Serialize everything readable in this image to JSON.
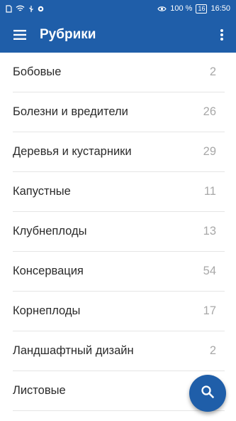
{
  "statusbar": {
    "battery_percent": "100 %",
    "time": "16:50",
    "battery_level": "16"
  },
  "appbar": {
    "title": "Рубрики"
  },
  "categories": [
    {
      "label": "Бобовые",
      "count": "2"
    },
    {
      "label": "Болезни и вредители",
      "count": "26"
    },
    {
      "label": "Деревья и кустарники",
      "count": "29"
    },
    {
      "label": "Капустные",
      "count": "11"
    },
    {
      "label": "Клубнеплоды",
      "count": "13"
    },
    {
      "label": "Консервация",
      "count": "54"
    },
    {
      "label": "Корнеплоды",
      "count": "17"
    },
    {
      "label": "Ландшафтный дизайн",
      "count": "2"
    },
    {
      "label": "Листовые",
      "count": ""
    }
  ],
  "icons": {
    "menu": "menu-icon",
    "more": "more-vertical-icon",
    "search": "search-icon"
  },
  "colors": {
    "primary": "#1f5ea9",
    "text": "#2b2b2b",
    "count": "#a8a8a8"
  }
}
